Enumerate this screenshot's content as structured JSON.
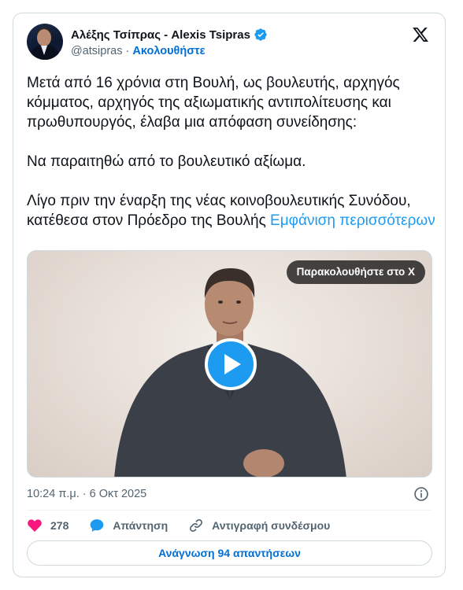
{
  "author": {
    "display_name": "Αλέξης Τσίπρας - Alexis Tsipras",
    "handle": "@atsipras",
    "separator": " · ",
    "follow_label": "Ακολουθήστε",
    "verified": true
  },
  "tweet": {
    "paragraphs": [
      "Μετά από 16 χρόνια στη Βουλή, ως βουλευτής, αρχηγός κόμματος, αρχηγός της αξιωματικής αντιπολίτευσης και πρωθυπουργός, έλαβα μια απόφαση συνείδησης:",
      "Να παραιτηθώ από το βουλευτικό αξίωμα."
    ],
    "last_paragraph": "Λίγο πριν την έναρξη της νέας κοινοβουλευτικής Συνόδου, κατέθεσα στον Πρόεδρο της Βουλής ",
    "show_more_label": "Εμφάνιση περισσότερων"
  },
  "video": {
    "watch_label": "Παρακολουθήστε στο X"
  },
  "meta": {
    "timestamp": "10:24 π.μ. · 6 Οκτ 2025"
  },
  "actions": {
    "likes_count": "278",
    "reply_label": "Απάντηση",
    "copy_link_label": "Αντιγραφή συνδέσμου"
  },
  "replies_button_label": "Ανάγνωση 94 απαντήσεων",
  "colors": {
    "accent": "#1d9bf0",
    "link": "#006fd6",
    "like": "#f91880",
    "muted": "#536471",
    "border": "#cfd9de"
  },
  "icons": [
    "verified-badge-icon",
    "x-logo-icon",
    "play-icon",
    "info-icon",
    "heart-icon",
    "reply-bubble-icon",
    "link-icon"
  ]
}
